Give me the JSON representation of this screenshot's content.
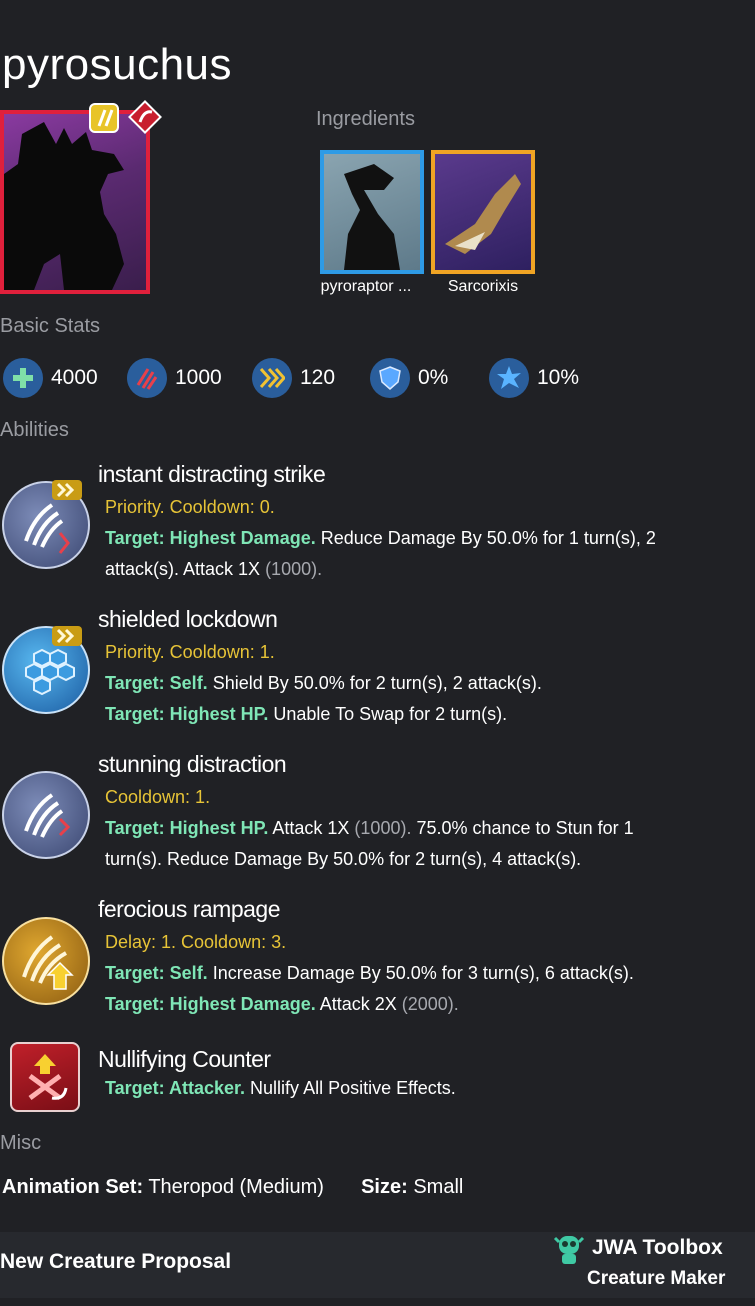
{
  "title": "pyrosuchus",
  "ingredients_label": "Ingredients",
  "ingredients": [
    {
      "name": "pyroraptor ...",
      "frame_color": "#2e9be6"
    },
    {
      "name": "Sarcorixis",
      "frame_color": "#f0a424"
    }
  ],
  "basic_stats_label": "Basic Stats",
  "stats": [
    {
      "icon": "health-plus-icon",
      "value": "4000"
    },
    {
      "icon": "damage-claw-icon",
      "value": "1000"
    },
    {
      "icon": "speed-chevron-icon",
      "value": "120"
    },
    {
      "icon": "armor-shield-icon",
      "value": "0%"
    },
    {
      "icon": "critical-burst-icon",
      "value": "10%"
    }
  ],
  "abilities_label": "Abilities",
  "abilities": [
    {
      "name": "instant distracting strike",
      "timing": "Priority. Cooldown: 0.",
      "lines": [
        {
          "target": "Target: Highest Damage.",
          "text": " Reduce Damage By 50.0% for 1 turn(s), 2",
          "extra": ""
        },
        {
          "target": "",
          "text": "attack(s). Attack 1X ",
          "extra": "(1000)."
        }
      ]
    },
    {
      "name": "shielded lockdown",
      "timing": "Priority. Cooldown: 1.",
      "lines": [
        {
          "target": "Target: Self.",
          "text": " Shield By 50.0% for 2 turn(s), 2 attack(s).",
          "extra": ""
        },
        {
          "target": "Target: Highest HP.",
          "text": " Unable To Swap for 2 turn(s).",
          "extra": ""
        }
      ]
    },
    {
      "name": "stunning distraction",
      "timing": "Cooldown: 1.",
      "lines": [
        {
          "target": "Target: Highest HP.",
          "text": " Attack 1X ",
          "extra": "(1000).",
          "tail": " 75.0% chance to Stun for 1"
        },
        {
          "target": "",
          "text": "turn(s). Reduce Damage By 50.0% for 2 turn(s), 4 attack(s).",
          "extra": ""
        }
      ]
    },
    {
      "name": "ferocious rampage",
      "timing": "Delay: 1. Cooldown: 3.",
      "lines": [
        {
          "target": "Target: Self.",
          "text": " Increase Damage By 50.0% for 3 turn(s), 6 attack(s).",
          "extra": ""
        },
        {
          "target": "Target: Highest Damage.",
          "text": " Attack 2X ",
          "extra": "(2000)."
        }
      ]
    }
  ],
  "counter": {
    "name": "Nullifying Counter",
    "target": "Target: Attacker.",
    "text": " Nullify All Positive Effects."
  },
  "misc_label": "Misc",
  "misc": {
    "animation_label": "Animation Set:",
    "animation_value": " Theropod (Medium)",
    "size_label": "Size:",
    "size_value": " Small"
  },
  "footer": {
    "left": "New Creature Proposal",
    "brand": "JWA Toolbox",
    "sub": "Creature Maker"
  },
  "colors": {
    "background": "#202125",
    "portrait_border": "#e0203c",
    "timing_yellow": "#e7c437",
    "target_green": "#7fe6b6"
  }
}
